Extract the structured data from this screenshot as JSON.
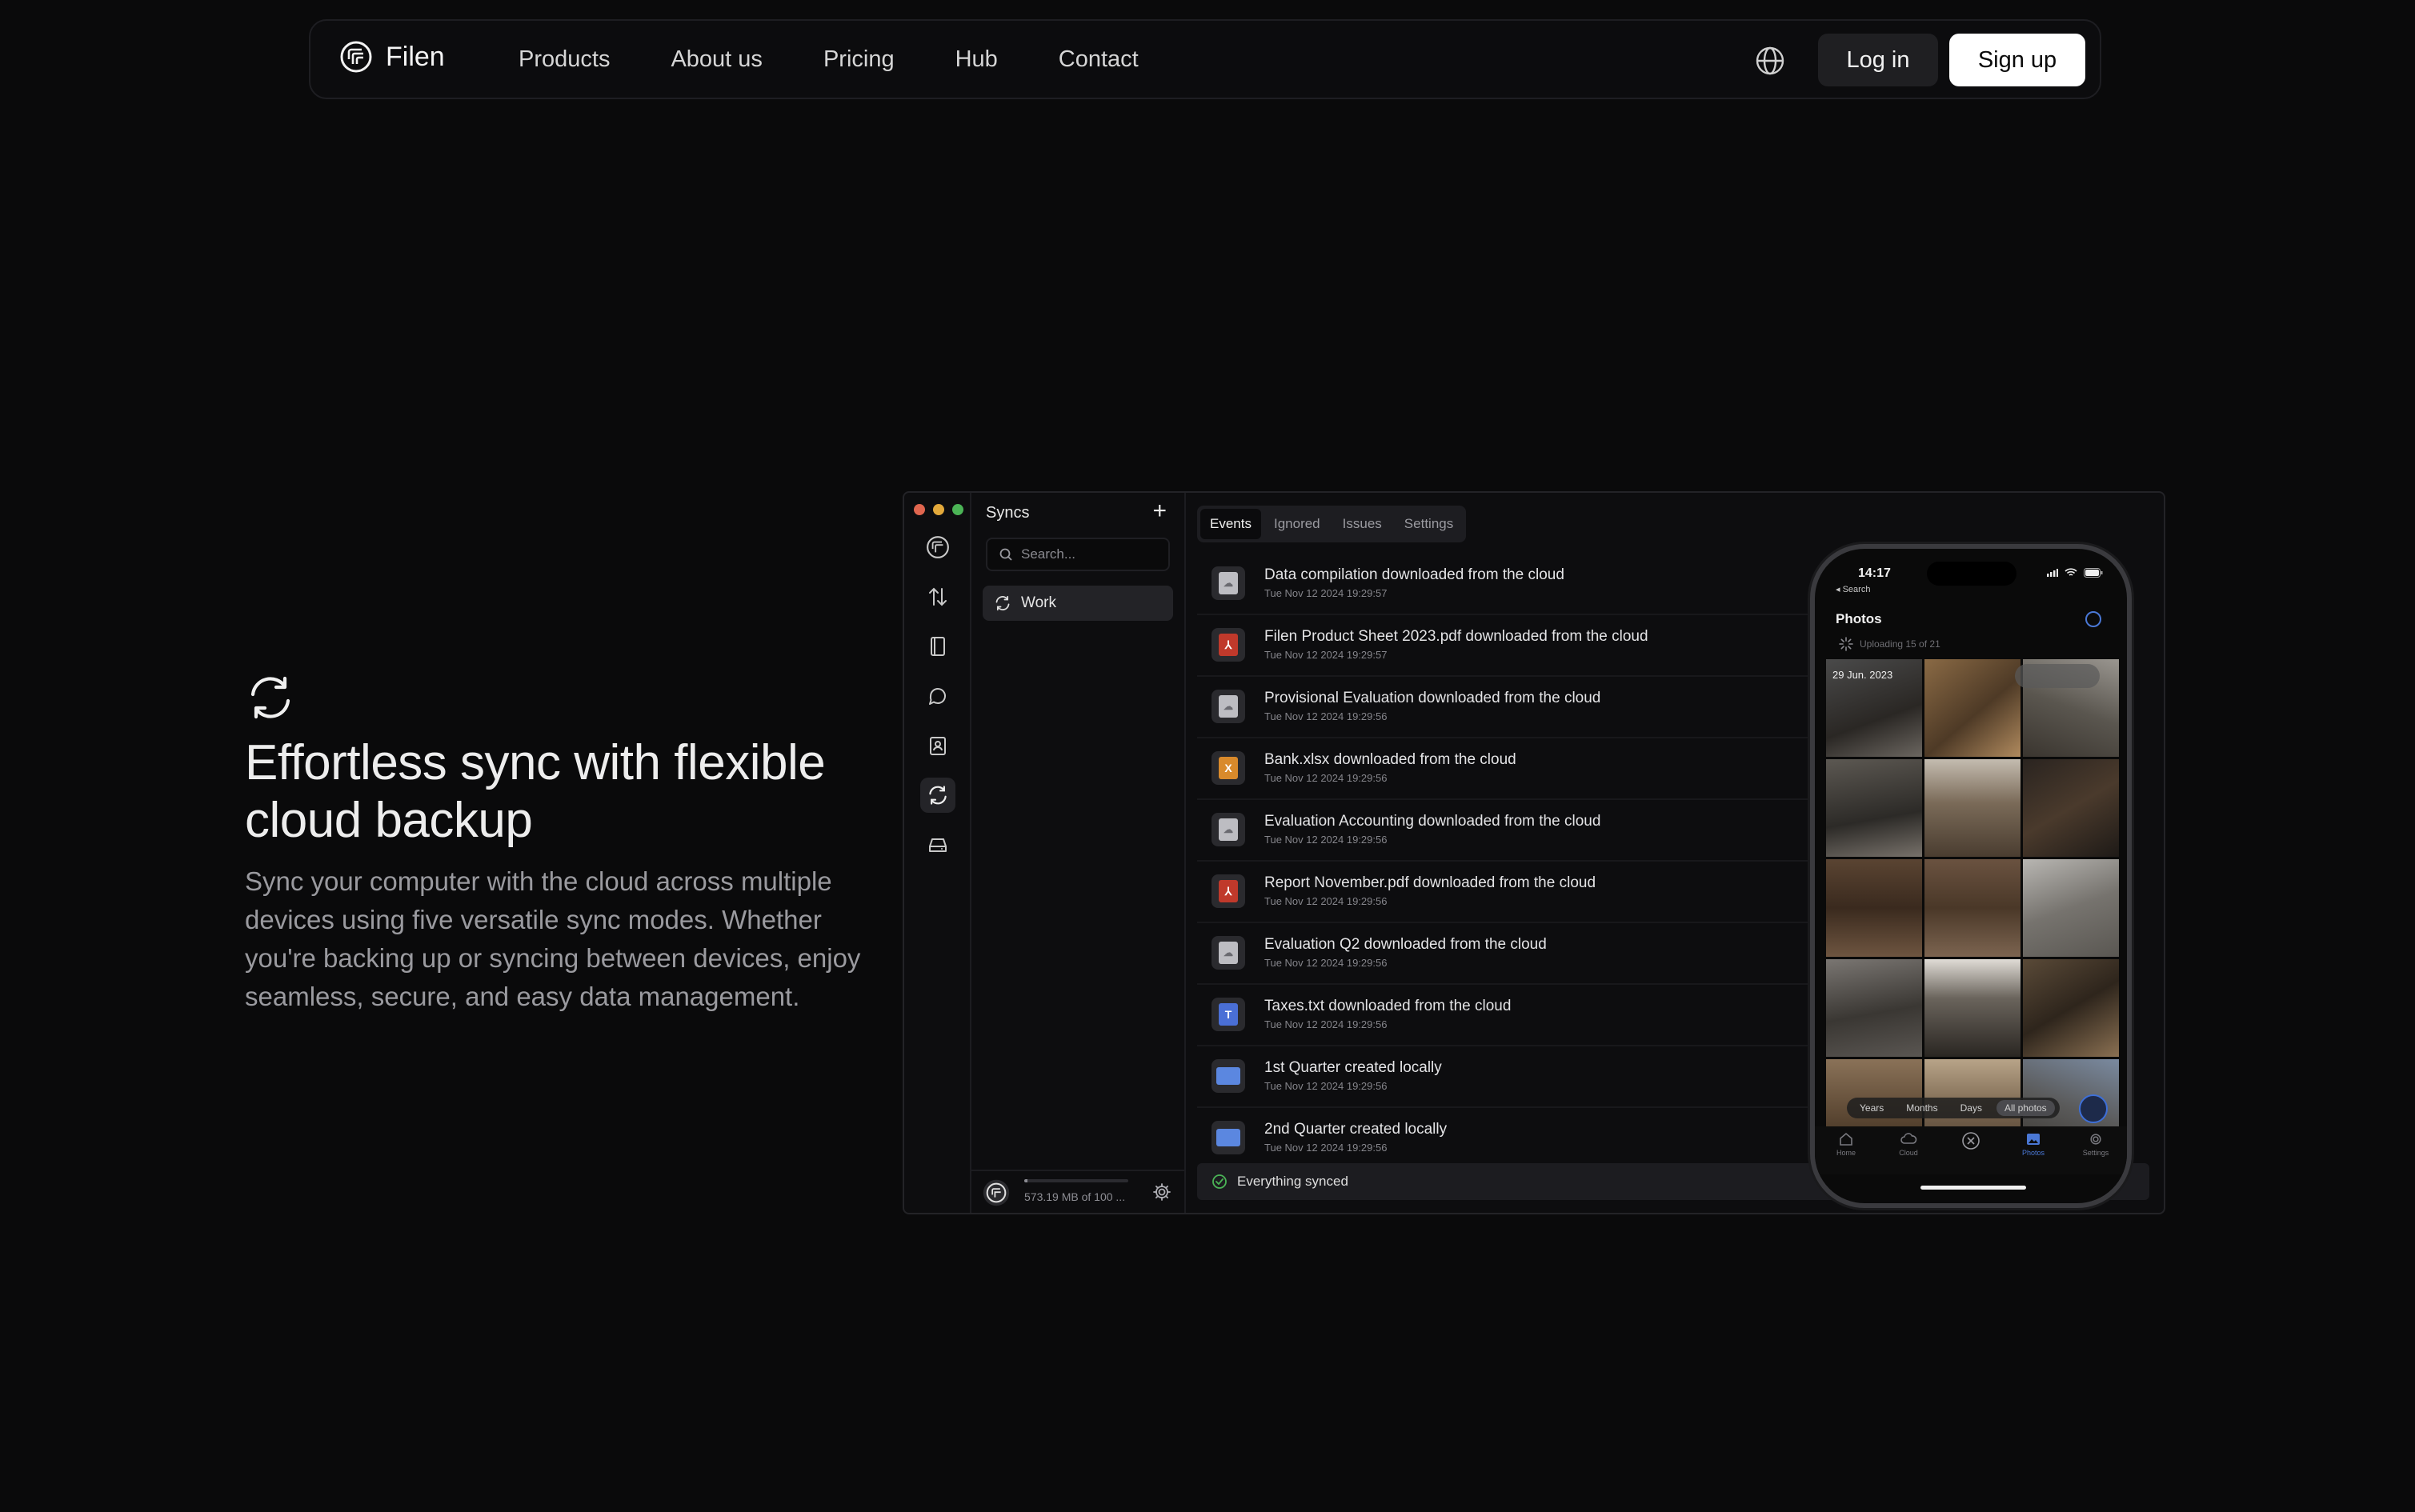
{
  "nav": {
    "brand": "Filen",
    "links": [
      "Products",
      "About us",
      "Pricing",
      "Hub",
      "Contact"
    ],
    "login": "Log in",
    "signup": "Sign up"
  },
  "hero": {
    "headline": "Effortless sync with flexible cloud backup",
    "subtext": "Sync your computer with the cloud across multiple devices using five versatile sync modes. Whether you're backing up or syncing between devices, enjoy seamless, secure, and easy data management."
  },
  "app": {
    "panel_title": "Syncs",
    "plus": "+",
    "search_placeholder": "Search...",
    "sync_item": "Work",
    "storage_text": "573.19 MB of 100 ...",
    "storage_fraction": 0.006,
    "tabs": [
      "Events",
      "Ignored",
      "Issues",
      "Settings"
    ],
    "events": [
      {
        "title": "Data compilation downloaded from the cloud",
        "time": "Tue Nov 12 2024 19:29:57",
        "icon": "generic-file-icon"
      },
      {
        "title": "Filen Product Sheet 2023.pdf downloaded from the cloud",
        "time": "Tue Nov 12 2024 19:29:57",
        "icon": "pdf-file-icon"
      },
      {
        "title": "Provisional Evaluation downloaded from the cloud",
        "time": "Tue Nov 12 2024 19:29:56",
        "icon": "generic-file-icon"
      },
      {
        "title": "Bank.xlsx downloaded from the cloud",
        "time": "Tue Nov 12 2024 19:29:56",
        "icon": "spreadsheet-file-icon"
      },
      {
        "title": "Evaluation Accounting downloaded from the cloud",
        "time": "Tue Nov 12 2024 19:29:56",
        "icon": "generic-file-icon"
      },
      {
        "title": "Report November.pdf downloaded from the cloud",
        "time": "Tue Nov 12 2024 19:29:56",
        "icon": "pdf-file-icon"
      },
      {
        "title": "Evaluation Q2 downloaded from the cloud",
        "time": "Tue Nov 12 2024 19:29:56",
        "icon": "generic-file-icon"
      },
      {
        "title": "Taxes.txt downloaded from the cloud",
        "time": "Tue Nov 12 2024 19:29:56",
        "icon": "text-file-icon"
      },
      {
        "title": "1st Quarter created locally",
        "time": "Tue Nov 12 2024 19:29:56",
        "icon": "folder-icon"
      },
      {
        "title": "2nd Quarter created locally",
        "time": "Tue Nov 12 2024 19:29:56",
        "icon": "folder-icon"
      }
    ],
    "status": "Everything synced"
  },
  "phone": {
    "time": "14:17",
    "back": "◂ Search",
    "title": "Photos",
    "uploading": "Uploading 15 of 21",
    "date_label": "29 Jun. 2023",
    "segments": [
      "Years",
      "Months",
      "Days",
      "All photos"
    ],
    "tabbar": [
      "Home",
      "Cloud",
      "",
      "Photos",
      "Settings"
    ]
  },
  "colors": {
    "background": "#0a0a0b",
    "pdf": "#c0392b",
    "spreadsheet": "#d98a2b",
    "text_file": "#4a6fd6",
    "folder": "#5b87e0",
    "accent": "#4a78d6"
  }
}
